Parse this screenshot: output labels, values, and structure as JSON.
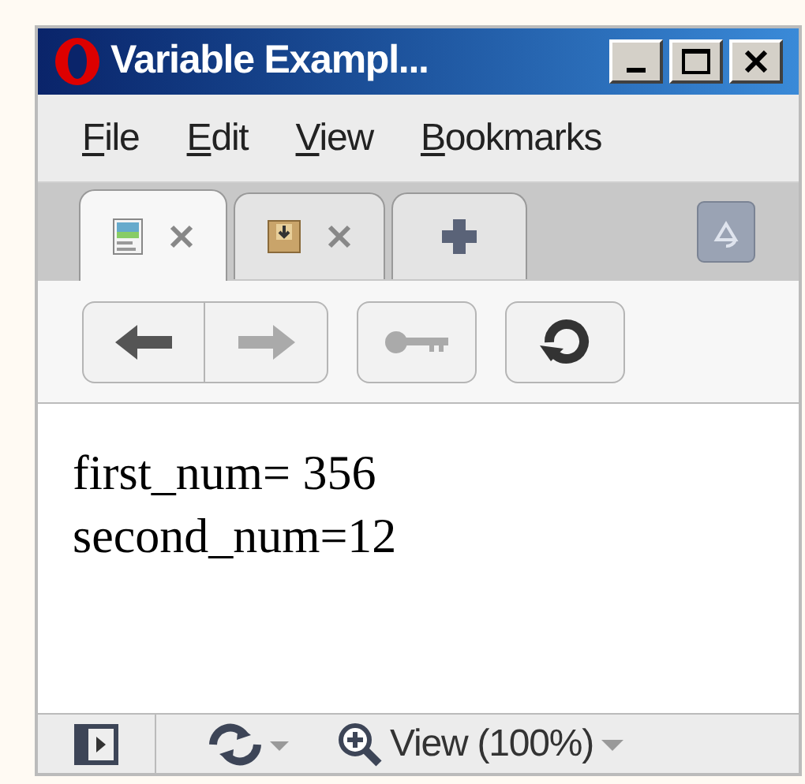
{
  "window": {
    "title": "Variable Exampl..."
  },
  "menu": [
    "File",
    "Edit",
    "View",
    "Bookmarks"
  ],
  "tabs": [
    {
      "kind": "page",
      "selected": true
    },
    {
      "kind": "download",
      "selected": false
    }
  ],
  "content": [
    "first_num= 356",
    "second_num=12"
  ],
  "status_bar": {
    "zoom": "View (100%)"
  }
}
